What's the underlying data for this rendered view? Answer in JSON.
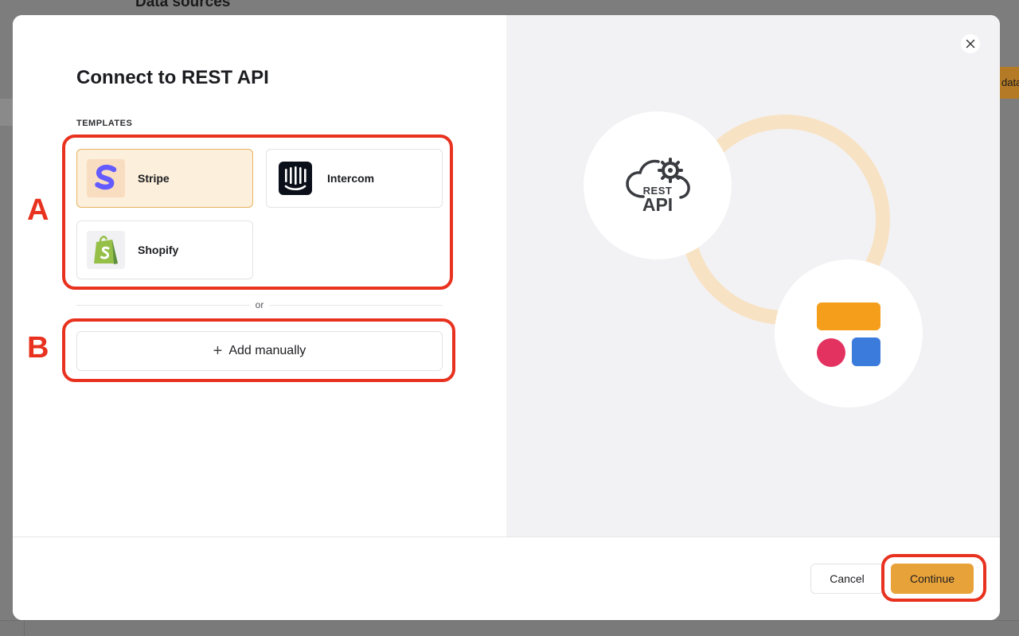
{
  "background": {
    "page_title": "Data sources",
    "partial_button": "data"
  },
  "modal": {
    "title": "Connect to REST API",
    "templates_label": "TEMPLATES",
    "templates": [
      {
        "name": "Stripe",
        "icon": "stripe-logo-icon",
        "selected": true
      },
      {
        "name": "Intercom",
        "icon": "intercom-logo-icon",
        "selected": false
      },
      {
        "name": "Shopify",
        "icon": "shopify-logo-icon",
        "selected": false
      }
    ],
    "divider_text": "or",
    "add_manually_label": "Add manually",
    "illustration": {
      "api_text_top": "REST",
      "api_text_bottom": "API"
    },
    "footer": {
      "cancel_label": "Cancel",
      "continue_label": "Continue"
    }
  },
  "annotations": {
    "label_a": "A",
    "label_b": "B"
  },
  "colors": {
    "accent": "#e8a23a",
    "selected_card_bg": "#fcefdb",
    "annotation": "#e8321f",
    "stripe": "#635bff",
    "shopify": "#95bf47",
    "tile_orange": "#f59e1b",
    "tile_pink": "#e3325f",
    "tile_blue": "#3a7bdc"
  }
}
